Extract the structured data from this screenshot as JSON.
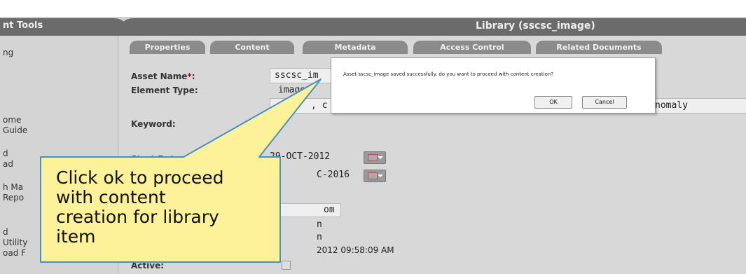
{
  "header": {
    "left_title": "nt Tools",
    "right_title": "Library (sscsc_image)"
  },
  "sidebar": {
    "items": [
      "ng",
      "ome",
      "Guide",
      "d",
      "ad",
      "h Ma",
      "Repo",
      "d",
      "Utility",
      "oad F"
    ]
  },
  "tabs": [
    "Properties",
    "Content",
    "Metadata",
    "Access Control",
    "Related Documents"
  ],
  "form": {
    "asset_name_label": "Asset Name",
    "required_mark": "*",
    "asset_name_colon": ":",
    "asset_name_value": "sscsc_im",
    "element_type_label": "Element Type:",
    "element_type_value": "image",
    "keyword_value_part1": "shu",
    "keyword_value_part2": ", c",
    "keyword_value_tail": "nomaly",
    "keyword_label": "Keyword:",
    "start_date_label_part": "Start Date",
    "start_date_value": "29-OCT-2012",
    "end_date_value": "C-2016",
    "owner_value": "om",
    "created_by_value": "n",
    "modified_by_value": "n",
    "modified_date_value": "2012 09:58:09 AM",
    "active_label": "Active:"
  },
  "dialog": {
    "message": "Asset sscsc_image saved successfully. do you want to proceed with content creation?",
    "ok_label": "OK",
    "cancel_label": "Cancel"
  },
  "callout": {
    "lines": [
      "Click ok to proceed",
      "with content",
      "creation for library",
      "item"
    ]
  },
  "colors": {
    "header_bg": "#6b6b6b",
    "tab_bg": "#8b8b8b",
    "callout_fill": "#fdf29a",
    "callout_border": "#4a90c8"
  }
}
